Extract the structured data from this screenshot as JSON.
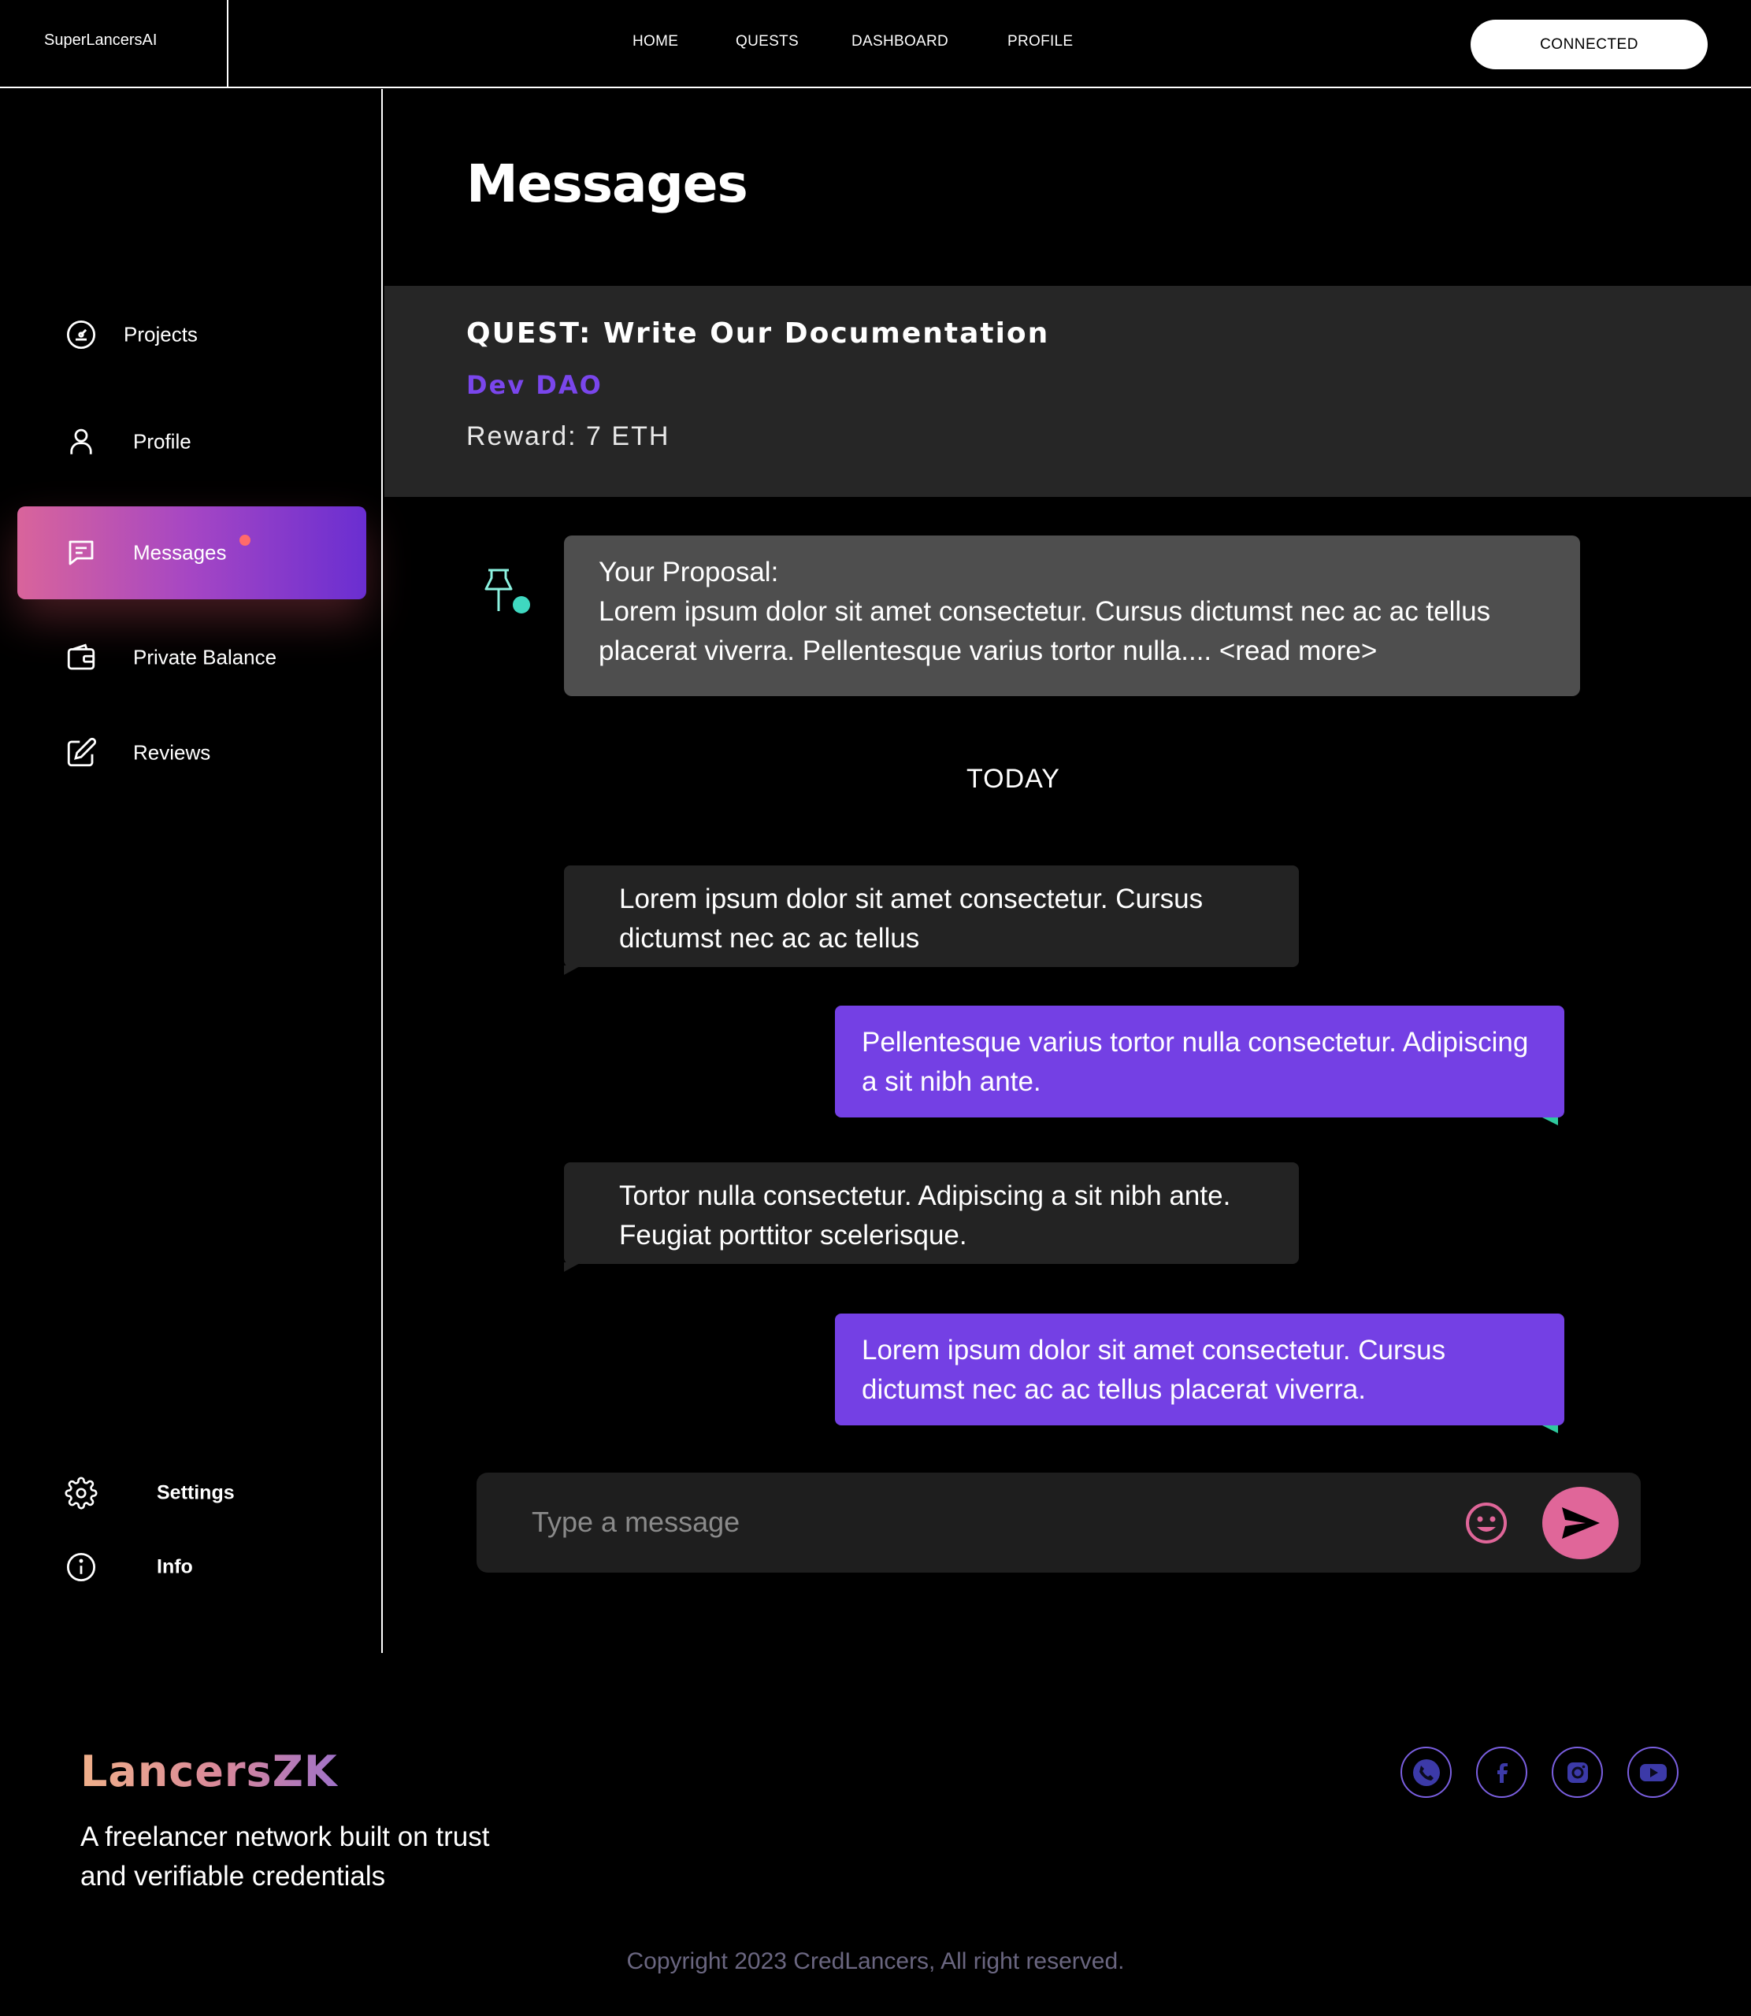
{
  "topnav": {
    "brand": "SuperLancersAI",
    "links": [
      "HOME",
      "QUESTS",
      "DASHBOARD",
      "PROFILE"
    ],
    "connect_label": "CONNECTED"
  },
  "sidebar": {
    "items": [
      {
        "label": "Projects",
        "icon": "gauge-icon"
      },
      {
        "label": "Profile",
        "icon": "user-icon"
      },
      {
        "label": "Messages",
        "icon": "chat-icon",
        "active": true,
        "has_notification": true
      },
      {
        "label": "Private Balance",
        "icon": "wallet-icon"
      },
      {
        "label": "Reviews",
        "icon": "edit-icon"
      }
    ],
    "bottom": [
      {
        "label": "Settings",
        "icon": "gear-icon"
      },
      {
        "label": "Info",
        "icon": "info-icon"
      }
    ]
  },
  "main": {
    "title": "Messages",
    "quest": {
      "title": "QUEST: Write Our Documentation",
      "org": "Dev DAO",
      "reward": "Reward: 7 ETH"
    },
    "proposal": {
      "heading": "Your Proposal:",
      "text": "Lorem ipsum dolor sit amet consectetur. Cursus dictumst nec ac ac tellus placerat viverra. Pellentesque varius tortor nulla.... <read more>"
    },
    "day_separator": "TODAY",
    "messages": [
      {
        "direction": "in",
        "text": "Lorem ipsum dolor sit amet consectetur. Cursus dictumst nec ac ac tellus"
      },
      {
        "direction": "out",
        "text": "Pellentesque varius tortor nulla consectetur. Adipiscing a sit nibh ante."
      },
      {
        "direction": "in",
        "text": "Tortor nulla consectetur. Adipiscing a sit nibh ante. Feugiat porttitor scelerisque."
      },
      {
        "direction": "out",
        "text": "Lorem ipsum dolor sit amet consectetur. Cursus dictumst nec ac ac tellus placerat viverra."
      }
    ],
    "composer": {
      "placeholder": "Type a message",
      "value": ""
    }
  },
  "footer": {
    "logo": "LancersZK",
    "tagline": "A freelancer network built on trust and verifiable credentials",
    "socials": [
      "phone-icon",
      "facebook-icon",
      "instagram-icon",
      "youtube-icon"
    ],
    "copyright": "Copyright 2023 CredLancers, All right reserved."
  },
  "colors": {
    "accent_purple": "#7440e4",
    "accent_pink": "#e06699",
    "org_purple": "#7a46ec",
    "teal": "#2ec89d",
    "notification": "#ff6b6b"
  }
}
